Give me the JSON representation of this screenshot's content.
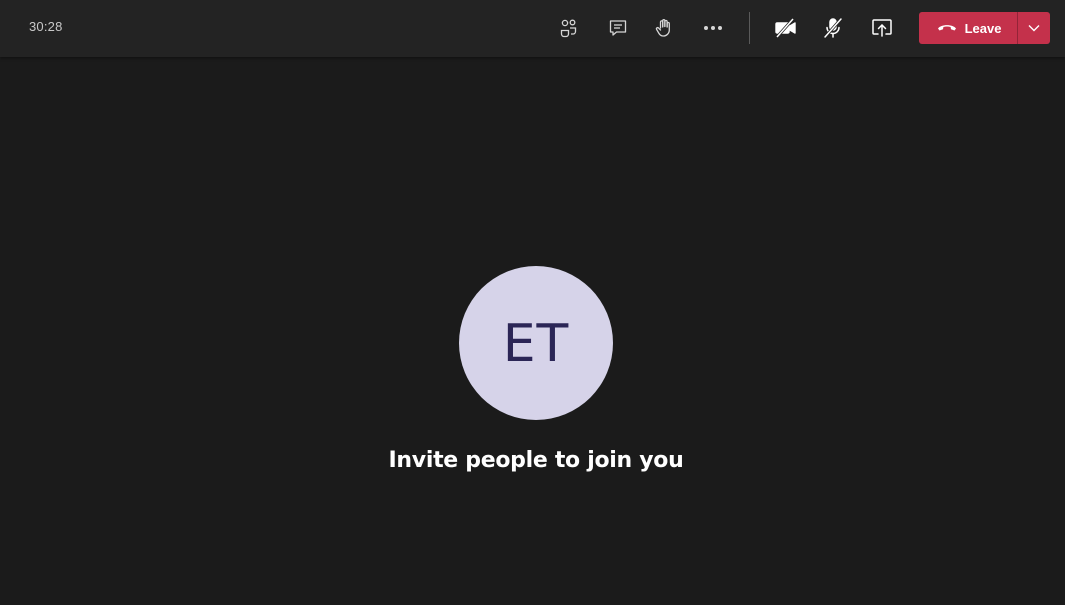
{
  "call": {
    "timer": "30:28"
  },
  "toolbar": {
    "icons": [
      "people-icon",
      "chat-icon",
      "raise-hand-icon",
      "more-icon",
      "camera-off-icon",
      "mic-off-icon",
      "share-screen-icon"
    ],
    "leave_label": "Leave"
  },
  "stage": {
    "avatar_initials": "ET",
    "invite_text": "Invite people to join you"
  },
  "colors": {
    "background": "#1b1b1b",
    "topbar": "#232323",
    "leave": "#c4314b",
    "avatar_bg": "#d6d3e9",
    "avatar_text": "#2b2556"
  }
}
